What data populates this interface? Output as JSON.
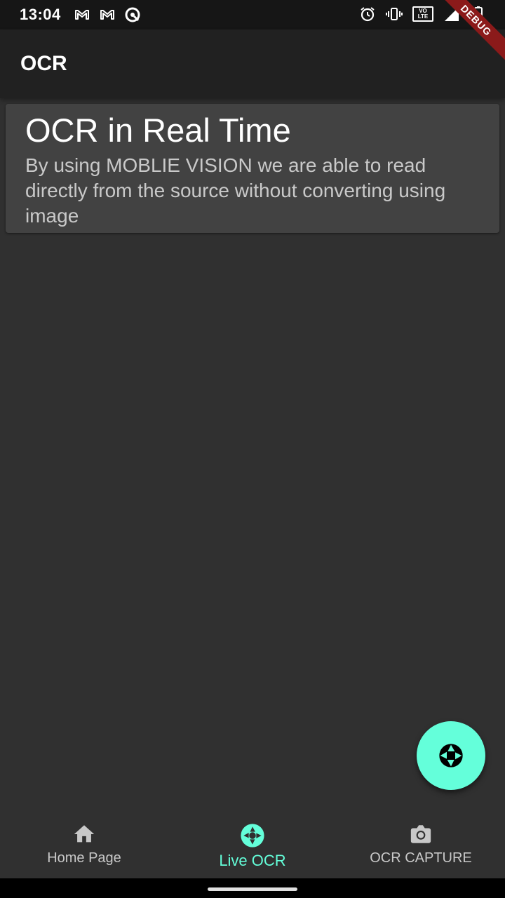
{
  "status_bar": {
    "time": "13:04",
    "left_icons": [
      "gmail-icon",
      "gmail-icon",
      "data-saver-icon"
    ],
    "right_icons": [
      "alarm-icon",
      "vibrate-icon",
      "volte-icon",
      "signal-icon",
      "battery-icon"
    ],
    "volte_top": "VO",
    "volte_bottom": "LTE"
  },
  "debug_banner": "DEBUG",
  "app_bar": {
    "title": "OCR"
  },
  "card": {
    "title": "OCR in Real Time",
    "subtitle": "By using MOBLIE VISION we are able to read directly from the source without converting using image"
  },
  "fab": {
    "icon": "camera-shutter-icon"
  },
  "bottom_nav": {
    "items": [
      {
        "label": "Home Page",
        "icon": "home-icon",
        "active": false
      },
      {
        "label": "Live OCR",
        "icon": "camera-shutter-icon",
        "active": true
      },
      {
        "label": "OCR CAPTURE",
        "icon": "camera-icon",
        "active": false
      }
    ]
  },
  "colors": {
    "accent": "#64ffda",
    "background": "#303030",
    "app_bar": "#212121",
    "card": "#424242",
    "debug": "#8b1a1a"
  }
}
